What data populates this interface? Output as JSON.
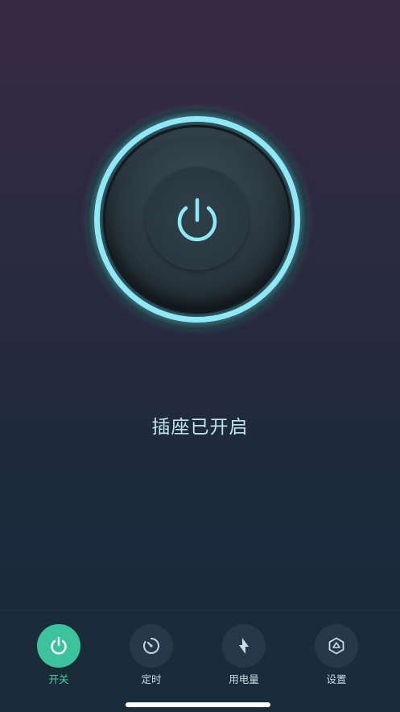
{
  "colors": {
    "accent": "#3dc39b",
    "glow": "#8ee8f6",
    "status_text": "#bfe7ea"
  },
  "main": {
    "power_button_icon": "power-icon",
    "status_text": "插座已开启"
  },
  "tabbar": {
    "tabs": [
      {
        "label": "开关",
        "icon": "power-icon",
        "active": true
      },
      {
        "label": "定时",
        "icon": "timer-icon",
        "active": false
      },
      {
        "label": "用电量",
        "icon": "lightning-icon",
        "active": false
      },
      {
        "label": "设置",
        "icon": "settings-cube-icon",
        "active": false
      }
    ]
  }
}
